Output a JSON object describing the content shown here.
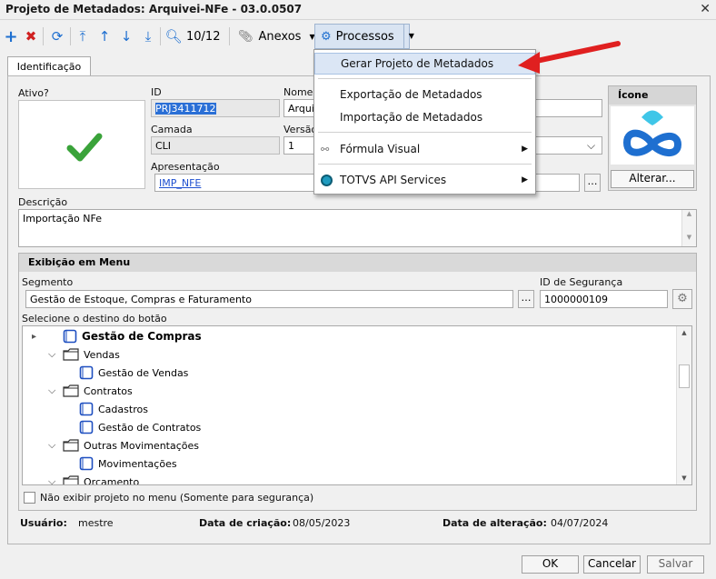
{
  "window": {
    "title": "Projeto de Metadados: Arquivei-NFe - 03.0.0507"
  },
  "toolbar": {
    "counter": "10/12",
    "attachments_label": "Anexos",
    "processes_label": "Processos"
  },
  "tabs": {
    "identification": "Identificação"
  },
  "form": {
    "active_label": "Ativo?",
    "id_label": "ID",
    "id_value": "PRJ3411712",
    "name_label": "Nome",
    "name_value": "Arquiv",
    "layer_label": "Camada",
    "layer_value": "CLI",
    "version_label": "Versão",
    "version_value": "1",
    "presentation_label": "Apresentação",
    "presentation_value": "IMP_NFE",
    "icon_label": "Ícone",
    "icon_change_button": "Alterar...",
    "description_label": "Descrição",
    "description_value": "Importação NFe"
  },
  "menu_display": {
    "header": "Exibição em Menu",
    "segment_label": "Segmento",
    "segment_value": "Gestão de Estoque, Compras e Faturamento",
    "security_id_label": "ID de Segurança",
    "security_id_value": "1000000109",
    "destination_label": "Selecione o destino do botão",
    "tree": [
      {
        "label": "Gestão de Compras",
        "kind": "doc",
        "bold": true
      },
      {
        "label": "Vendas",
        "kind": "folder"
      },
      {
        "label": "Gestão de Vendas",
        "kind": "doc"
      },
      {
        "label": "Contratos",
        "kind": "folder"
      },
      {
        "label": "Cadastros",
        "kind": "doc"
      },
      {
        "label": "Gestão de Contratos",
        "kind": "doc"
      },
      {
        "label": "Outras Movimentações",
        "kind": "folder"
      },
      {
        "label": "Movimentações",
        "kind": "doc"
      },
      {
        "label": "Orcamento",
        "kind": "folder"
      }
    ],
    "hide_checkbox_label": "Não exibir projeto no menu (Somente para segurança)"
  },
  "footer": {
    "user_label": "Usuário:",
    "user_value": "mestre",
    "created_label": "Data de criação:",
    "created_value": "08/05/2023",
    "changed_label": "Data de alteração:",
    "changed_value": "04/07/2024"
  },
  "dialog_buttons": {
    "ok": "OK",
    "cancel": "Cancelar",
    "save": "Salvar"
  },
  "dropdown": {
    "items": [
      "Gerar Projeto de Metadados",
      "Exportação de Metadados",
      "Importação de Metadados",
      "Fórmula Visual",
      "TOTVS API Services"
    ]
  },
  "colors": {
    "accent_blue": "#1e6fd0",
    "check_green": "#3aa33a",
    "arrow_red": "#e02020",
    "icon_cyan": "#3fc6e8"
  }
}
